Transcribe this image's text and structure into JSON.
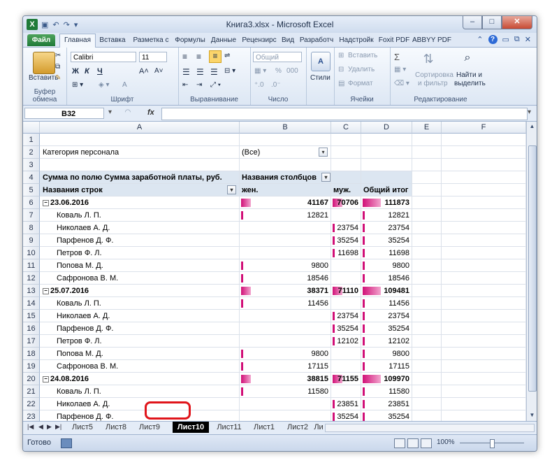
{
  "window": {
    "title": "Книга3.xlsx - Microsoft Excel",
    "controls": [
      "–",
      "□",
      "✕"
    ]
  },
  "ribbon_tabs": [
    "Файл",
    "Главная",
    "Вставка",
    "Разметка с",
    "Формулы",
    "Данные",
    "Рецензирс",
    "Вид",
    "Разработч",
    "Надстройк",
    "Foxit PDF",
    "ABBYY PDF"
  ],
  "ribbon": {
    "clipboard": {
      "paste": "Вставить",
      "label": "Буфер обмена"
    },
    "font": {
      "name": "Calibri",
      "size": "11",
      "bold": "Ж",
      "italic": "К",
      "underline": "Ч",
      "grow": "A˄",
      "shrink": "A˅",
      "color": "A",
      "label": "Шрифт"
    },
    "alignment": {
      "label": "Выравнивание"
    },
    "number": {
      "format": "Общий",
      "percent": "%",
      "thousands": "000",
      "label": "Число"
    },
    "styles": {
      "label": "Стили"
    },
    "cells": {
      "insert": "Вставить",
      "delete": "Удалить",
      "format": "Формат",
      "label": "Ячейки"
    },
    "editing": {
      "sum": "Σ",
      "sort1": "Сортировка",
      "sort2": "и фильтр",
      "find1": "Найти и",
      "find2": "выделить",
      "label": "Редактирование"
    }
  },
  "formula_bar": {
    "name_box": "B32",
    "fx": "fx",
    "value": ""
  },
  "columns": [
    "A",
    "B",
    "C",
    "D",
    "E",
    "F"
  ],
  "rows": [
    {
      "n": "1"
    },
    {
      "n": "2",
      "a": "Категория персонала",
      "b": "(Все)",
      "filter": true
    },
    {
      "n": "3"
    },
    {
      "n": "4",
      "a": "Сумма по полю Сумма заработной платы, руб.",
      "b": "Названия столбцов",
      "hdr": true
    },
    {
      "n": "5",
      "a": "Названия строк",
      "b": "жен.",
      "c": "муж.",
      "d": "Общий итог",
      "hdr": true
    },
    {
      "n": "6",
      "a": "23.06.2016",
      "b": "41167",
      "c": "70706",
      "d": "111873",
      "group": true
    },
    {
      "n": "7",
      "a": "Коваль Л. П.",
      "b": "12821",
      "d": "12821"
    },
    {
      "n": "8",
      "a": "Николаев А. Д.",
      "c": "23754",
      "d": "23754"
    },
    {
      "n": "9",
      "a": "Парфенов Д. Ф.",
      "c": "35254",
      "d": "35254"
    },
    {
      "n": "10",
      "a": "Петров Ф. Л.",
      "c": "11698",
      "d": "11698"
    },
    {
      "n": "11",
      "a": "Попова М. Д.",
      "b": "9800",
      "d": "9800"
    },
    {
      "n": "12",
      "a": "Сафронова В. М.",
      "b": "18546",
      "d": "18546"
    },
    {
      "n": "13",
      "a": "25.07.2016",
      "b": "38371",
      "c": "71110",
      "d": "109481",
      "group": true
    },
    {
      "n": "14",
      "a": "Коваль Л. П.",
      "b": "11456",
      "d": "11456"
    },
    {
      "n": "15",
      "a": "Николаев А. Д.",
      "c": "23754",
      "d": "23754"
    },
    {
      "n": "16",
      "a": "Парфенов Д. Ф.",
      "c": "35254",
      "d": "35254"
    },
    {
      "n": "17",
      "a": "Петров Ф. Л.",
      "c": "12102",
      "d": "12102"
    },
    {
      "n": "18",
      "a": "Попова М. Д.",
      "b": "9800",
      "d": "9800"
    },
    {
      "n": "19",
      "a": "Сафронова В. М.",
      "b": "17115",
      "d": "17115"
    },
    {
      "n": "20",
      "a": "24.08.2016",
      "b": "38815",
      "c": "71155",
      "d": "109970",
      "group": true
    },
    {
      "n": "21",
      "a": "Коваль Л. П.",
      "b": "11580",
      "d": "11580"
    },
    {
      "n": "22",
      "a": "Николаев А. Д.",
      "c": "23851",
      "d": "23851"
    },
    {
      "n": "23",
      "a": "Парфенов Д. Ф.",
      "c": "35254",
      "d": "35254"
    }
  ],
  "sheet_tabs": [
    "Лист5",
    "Лист8",
    "Лист9",
    "Лист10",
    "Лист11",
    "Лист1",
    "Лист2",
    "Ли"
  ],
  "active_sheet": "Лист10",
  "status": {
    "ready": "Готово",
    "zoom": "100%"
  },
  "colors": {
    "accent_bar": "#d10f77",
    "pivot_header": "#dce6f1",
    "highlight": "#e0151b"
  }
}
